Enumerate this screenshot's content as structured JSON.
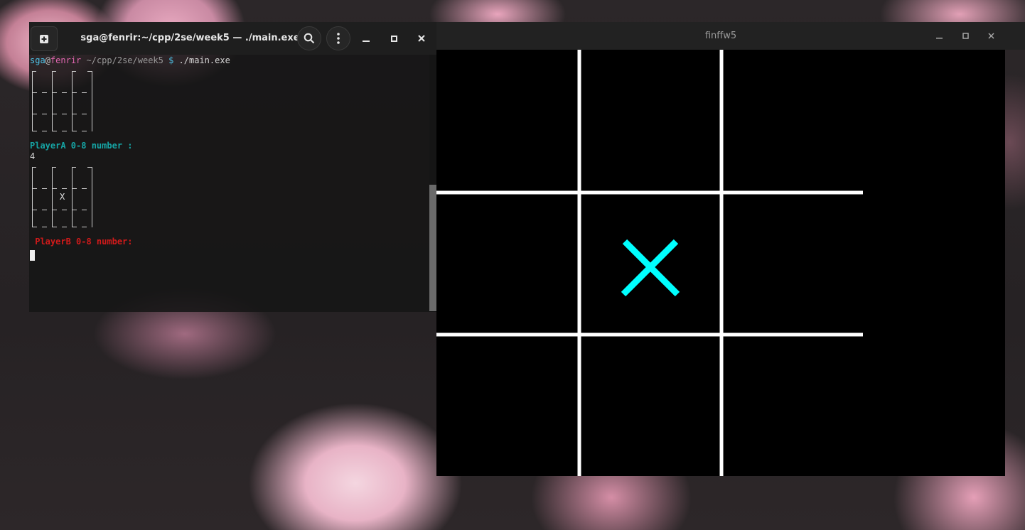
{
  "terminal": {
    "title": "sga@fenrir:~/cpp/2se/week5 — ./main.exe",
    "new_tab_icon": "new-tab-icon",
    "prompt": {
      "user": "sga",
      "at": "@",
      "host": "fenrir",
      "path": " ~/cpp/2se/week5",
      "dollar": " $",
      "command": " ./main.exe"
    },
    "lines": {
      "playerA_prompt": "PlayerA 0-8 number :",
      "playerA_input": "4",
      "board_mark": "X",
      "playerB_prompt": " PlayerB 0-8 number:"
    },
    "buttons": {
      "new_tab": "⊞",
      "search": "⌕",
      "menu": "⋮",
      "minimize": "—",
      "maximize": "▫",
      "close": "✕"
    },
    "colors": {
      "playerA": "#16a5a5",
      "playerB": "#d11a1a"
    }
  },
  "game_window": {
    "title": "finffw5",
    "buttons": {
      "minimize": "—",
      "maximize": "▫",
      "close": "✕"
    },
    "board": {
      "rows": 3,
      "cols": 3,
      "cells": [
        "",
        "",
        "",
        "",
        "X",
        "",
        "",
        "",
        ""
      ],
      "x_color": "#00ffff",
      "line_color": "#ffffff",
      "background": "#000000"
    }
  }
}
